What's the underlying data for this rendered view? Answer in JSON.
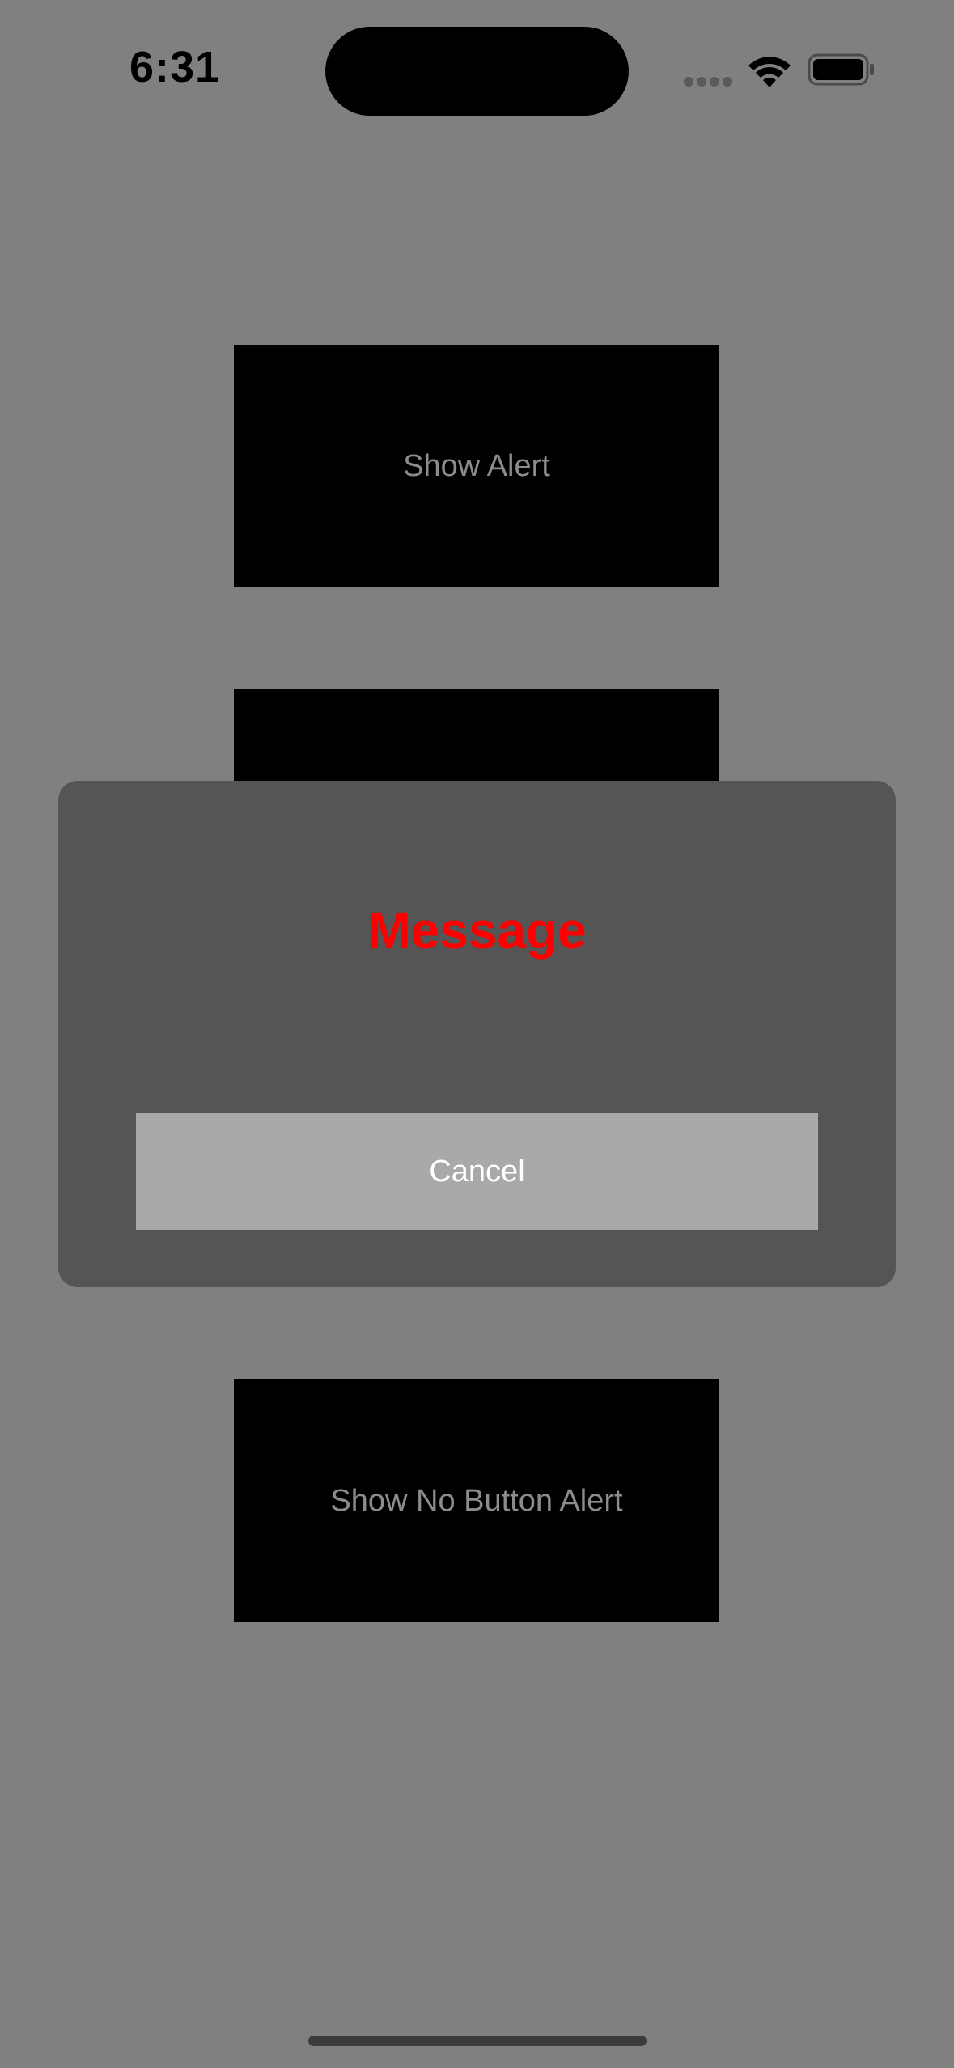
{
  "status_bar": {
    "time": "6:31",
    "icons": [
      "signal-dots-icon",
      "wifi-icon",
      "battery-icon"
    ]
  },
  "buttons": {
    "show_alert": "Show Alert",
    "hidden_button": "",
    "show_no_button_alert": "Show No Button Alert"
  },
  "alert": {
    "message": "Message",
    "cancel_label": "Cancel"
  },
  "colors": {
    "background": "#808080",
    "button_background": "#000000",
    "button_text": "#8c8c8c",
    "alert_background": "#555555",
    "alert_message": "#ff0000",
    "cancel_background": "#a9a9a9",
    "cancel_text": "#ffffff"
  }
}
